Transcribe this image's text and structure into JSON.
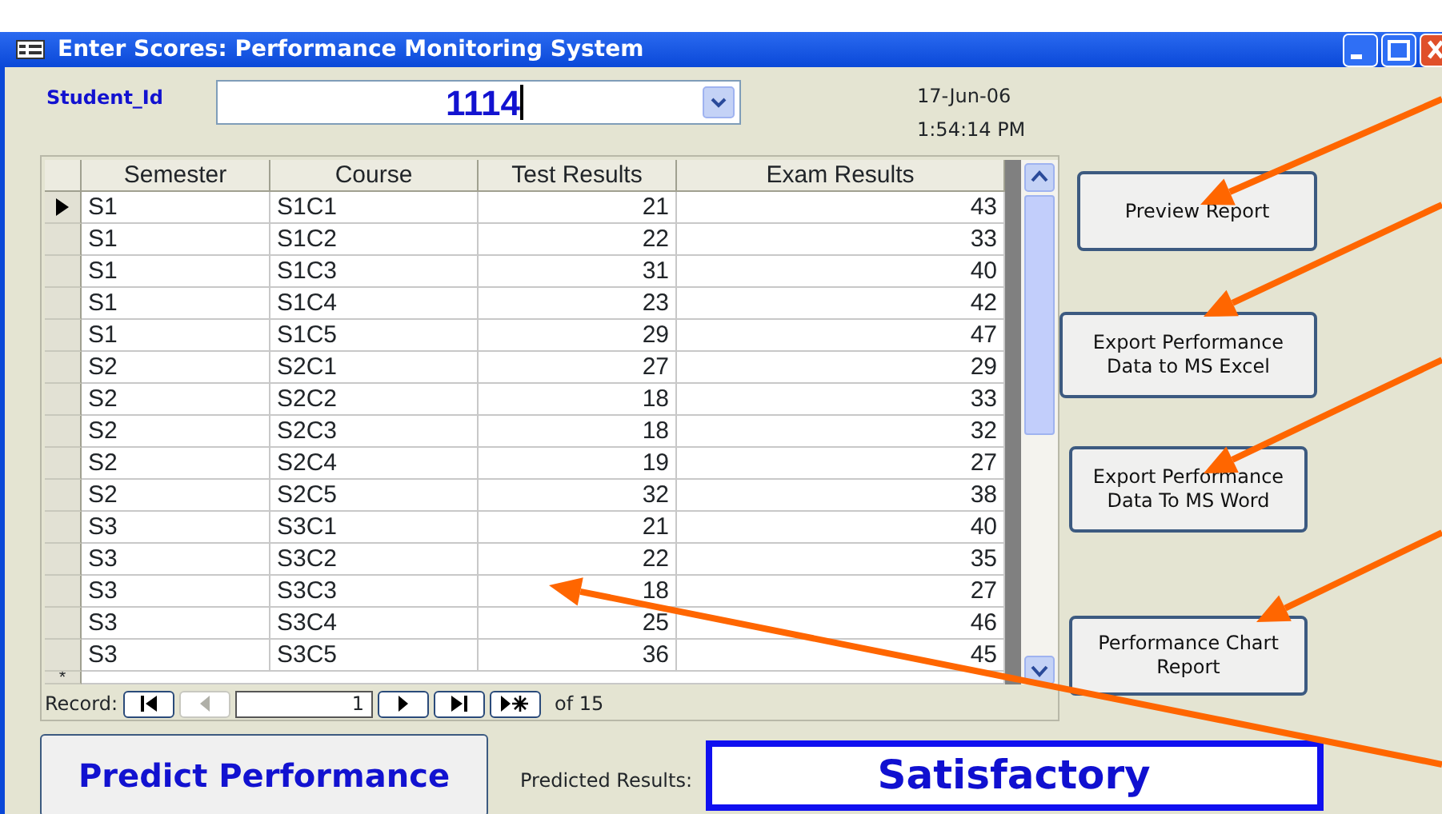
{
  "window": {
    "title": "Enter Scores: Performance Monitoring System"
  },
  "student": {
    "label": "Student_Id",
    "value": "1114"
  },
  "date": "17-Jun-06",
  "time": "1:54:14 PM",
  "table": {
    "columns": [
      "Semester",
      "Course",
      "Test Results",
      "Exam Results"
    ],
    "rows": [
      {
        "cells": [
          "S1",
          "S1C1",
          "21",
          "43"
        ],
        "selected": true
      },
      {
        "cells": [
          "S1",
          "S1C2",
          "22",
          "33"
        ],
        "selected": false
      },
      {
        "cells": [
          "S1",
          "S1C3",
          "31",
          "40"
        ],
        "selected": false
      },
      {
        "cells": [
          "S1",
          "S1C4",
          "23",
          "42"
        ],
        "selected": false
      },
      {
        "cells": [
          "S1",
          "S1C5",
          "29",
          "47"
        ],
        "selected": false
      },
      {
        "cells": [
          "S2",
          "S2C1",
          "27",
          "29"
        ],
        "selected": false
      },
      {
        "cells": [
          "S2",
          "S2C2",
          "18",
          "33"
        ],
        "selected": false
      },
      {
        "cells": [
          "S2",
          "S2C3",
          "18",
          "32"
        ],
        "selected": false
      },
      {
        "cells": [
          "S2",
          "S2C4",
          "19",
          "27"
        ],
        "selected": false
      },
      {
        "cells": [
          "S2",
          "S2C5",
          "32",
          "38"
        ],
        "selected": false
      },
      {
        "cells": [
          "S3",
          "S3C1",
          "21",
          "40"
        ],
        "selected": false
      },
      {
        "cells": [
          "S3",
          "S3C2",
          "22",
          "35"
        ],
        "selected": false
      },
      {
        "cells": [
          "S3",
          "S3C3",
          "18",
          "27"
        ],
        "selected": false
      },
      {
        "cells": [
          "S3",
          "S3C4",
          "25",
          "46"
        ],
        "selected": false
      },
      {
        "cells": [
          "S3",
          "S3C5",
          "36",
          "45"
        ],
        "selected": false
      }
    ],
    "new_row_marker": "*"
  },
  "navigator": {
    "label": "Record:",
    "current": "1",
    "total": "of 15"
  },
  "side_buttons": [
    "Preview Report",
    "Export Performance\nData  to MS Excel",
    "Export Performance\nData To MS Word",
    "Performance Chart\nReport"
  ],
  "predict_button": "Predict Performance",
  "result": {
    "label": "Predicted Results:",
    "value": "Satisfactory"
  }
}
